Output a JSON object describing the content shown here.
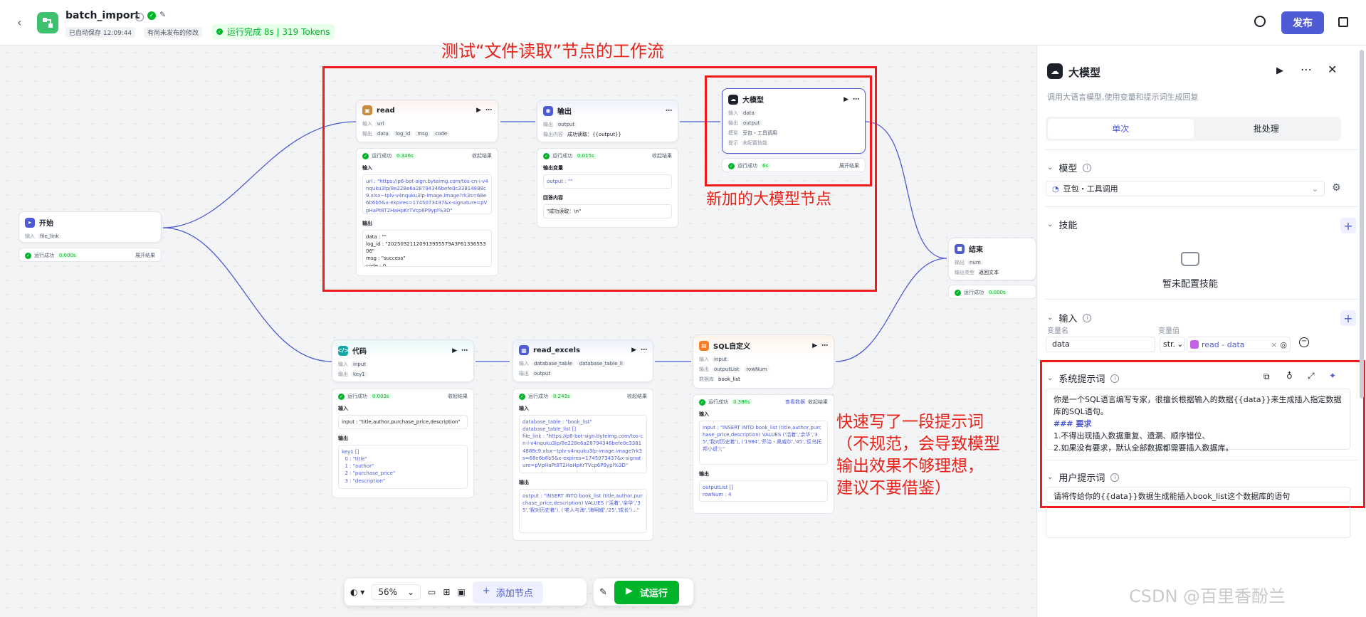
{
  "app": {
    "title": "batch_import",
    "autosave": "已自动保存 12:09:44",
    "unpublished": "有尚未发布的修改",
    "run_status": "运行完成 8s | 319 Tokens",
    "publish": "发布",
    "brand_color": "#4e5bd5",
    "success_color": "#00b42a"
  },
  "toolbar": {
    "zoom": "56%",
    "add_node": "添加节点",
    "test_run": "试运行"
  },
  "annotations": {
    "title": "测试“文件读取”节点的工作流",
    "new_node": "新加的大模型节点",
    "prompt_note": "快速写了一段提示词\n（不规范，会导致模型\n输出效果不够理想，\n建议不要借鉴）"
  },
  "common": {
    "input": "输入",
    "output": "输出",
    "run_ok": "运行成功",
    "collapse": "收起结果",
    "expand": "展开结果",
    "view_data": "查看数据",
    "output_vars": "输出变量",
    "reply_content": "回答内容",
    "db": "数据库",
    "model": "模型",
    "prompt": "提示",
    "output_type": "输出类型",
    "output_format": "输出内容"
  },
  "nodes": {
    "start": {
      "title": "开始",
      "input": "file_link",
      "time": "0.000s"
    },
    "read": {
      "title": "read",
      "input": "url",
      "outputs": [
        "data",
        "log_id",
        "msg",
        "code"
      ],
      "time": "0.346s",
      "input_text": "url : \"https://p6-bot-sign.byteimg.com/tos-cn-i-v4nquku3lp/8e228e6a28794346befe0c33814888c9.xlsx~tplv-v4nquku3lp-image.image?rk3s=68e6b6b5&x-expires=1745073437&x-signature=pVpHaPt8T2HaHpKrTVcp6P9ypl%3D\"",
      "output_text": "data : \"\"\nlog_id : \"20250321120913955579A3F6133655306\"\nmsg : \"success\"\ncode : 0"
    },
    "output": {
      "title": "输出",
      "output": "output",
      "format_value": "成功读取：{{output}}",
      "time": "0.015s",
      "var_text": "output : \"\"",
      "reply_text": "\"成功读取：\\n\""
    },
    "llm_node": {
      "title": "大模型",
      "input": "data",
      "output": "output",
      "model_value": "豆包・工具调用",
      "prompt_value": "未配置技能",
      "time": "6s"
    },
    "end": {
      "title": "结束",
      "output": "num",
      "output_type_value": "返回文本",
      "time": "0.000s"
    },
    "code": {
      "title": "代码",
      "input": "input",
      "output": "key1",
      "time": "0.003s",
      "input_text": "input : \"title,author,purchase_price,description\"",
      "output_text": "key1 []\n  0 : \"title\"\n  1 : \"author\"\n  2 : \"purchase_price\"\n  3 : \"description\""
    },
    "read_excels": {
      "title": "read_excels",
      "inputs": [
        "database_table",
        "database_table_li"
      ],
      "output": "output",
      "time": "0.243s",
      "input_text": "database_table : \"book_list\"\ndatabase_table_list []\nfile_link : \"https://p6-bot-sign.byteimg.com/tos-cn-i-v4nquku3lp/8e228e6a28794346befe0c33814888c9.xlsx~tplv-v4nquku3lp-image.image?rk3s=68e6b6b5&x-expires=1745073437&x-signature=pVpHaPt8T2HaHpKrTVcp6P9ypl%3D\"",
      "output_text": "output : \"INSERT INTO book_list (title,author,purchase_price,description) VALUES ('活着','余华','35','我对历史着'), ('老人与海','海明威','25','成长')...\""
    },
    "sql": {
      "title": "SQL自定义",
      "input": "input",
      "outputs": [
        "outputList",
        "rowNum"
      ],
      "db_value": "book_list",
      "time": "0.386s",
      "input_text": "input : \"INSERT INTO book_list (title,author,purchase_price,description) VALUES ('活着','余华','35','我对历史着'), ('1984','乔治・奥威尔','45','反乌托邦小说');\"",
      "output_text": "outputList []\nrowNum : 4"
    }
  },
  "panel": {
    "title": "大模型",
    "subtitle": "调用大语言模型,使用变量和提示词生成回复",
    "tabs": [
      "单次",
      "批处理"
    ],
    "model_section": "模型",
    "model_value": "豆包・工具调用",
    "skills_section": "技能",
    "skills_empty": "暂未配置技能",
    "input_section": "输入",
    "var_name_label": "变量名",
    "var_value_label": "变量值",
    "var_name": "data",
    "var_type": "str.",
    "var_ref": "read - data",
    "system_prompt_section": "系统提示词",
    "system_prompt_lines": [
      "你是一个SQL语言编写专家，很擅长根据输入的数据{{data}}来生成插入指定数据库的SQL语句。",
      "### 要求",
      "1.不得出现插入数据重复、遗漏、顺序错位、",
      "2.如果没有要求，默认全部数据都需要插入数据库。"
    ],
    "user_prompt_section": "用户提示词",
    "user_prompt": "请将传给你的{{data}}数据生成能插入book_list这个数据库的语句"
  },
  "watermark": "CSDN @百里香酚兰"
}
